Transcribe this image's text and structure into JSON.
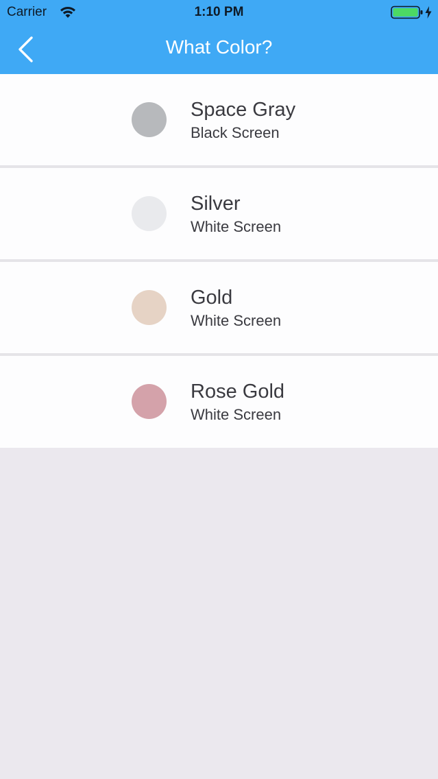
{
  "status_bar": {
    "carrier": "Carrier",
    "time": "1:10 PM",
    "battery_color": "#4cd964"
  },
  "nav": {
    "title": "What Color?",
    "back_icon": "chevron-left-icon",
    "bar_color": "#3fa9f5"
  },
  "colors": [
    {
      "name": "Space Gray",
      "subtitle": "Black Screen",
      "swatch": "#b7b9bc"
    },
    {
      "name": "Silver",
      "subtitle": "White Screen",
      "swatch": "#e9eaed"
    },
    {
      "name": "Gold",
      "subtitle": "White Screen",
      "swatch": "#e6d3c5"
    },
    {
      "name": "Rose Gold",
      "subtitle": "White Screen",
      "swatch": "#d4a2aa"
    }
  ]
}
